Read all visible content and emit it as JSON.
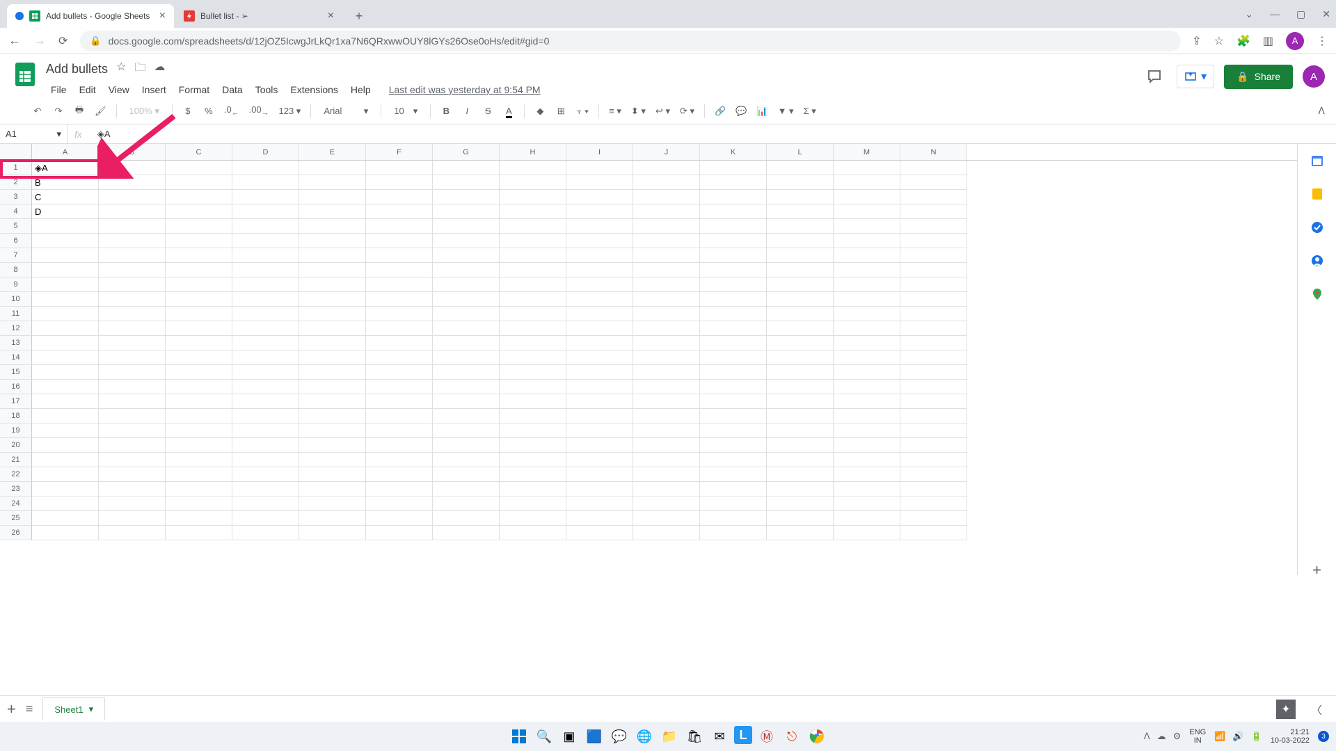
{
  "browser": {
    "tabs": [
      {
        "title": "Add bullets - Google Sheets",
        "icon": "sheets"
      },
      {
        "title": "Bullet list - ➢",
        "icon": "bolt"
      }
    ],
    "url": "docs.google.com/spreadsheets/d/12jOZ5IcwgJrLkQr1xa7N6QRxwwOUY8lGYs26Ose0oHs/edit#gid=0",
    "avatar_letter": "A"
  },
  "doc": {
    "title": "Add bullets",
    "menus": [
      "File",
      "Edit",
      "View",
      "Insert",
      "Format",
      "Data",
      "Tools",
      "Extensions",
      "Help"
    ],
    "last_edit": "Last edit was yesterday at 9:54 PM",
    "share_label": "Share"
  },
  "toolbar": {
    "zoom": "100%",
    "currency": "$",
    "percent": "%",
    "dec_dec": ".0",
    "inc_dec": ".00",
    "format123": "123",
    "font": "Arial",
    "font_size": "10"
  },
  "namebox": "A1",
  "formula": "◈A",
  "columns": [
    "A",
    "B",
    "C",
    "D",
    "E",
    "F",
    "G",
    "H",
    "I",
    "J",
    "K",
    "L",
    "M",
    "N"
  ],
  "rows": 26,
  "cells": {
    "A1": "◈A",
    "A2": "B",
    "A3": "C",
    "A4": "D"
  },
  "sheet_tab": "Sheet1",
  "system": {
    "lang_top": "ENG",
    "lang_bottom": "IN",
    "time": "21:21",
    "date": "10-03-2022",
    "notif_count": "3"
  }
}
